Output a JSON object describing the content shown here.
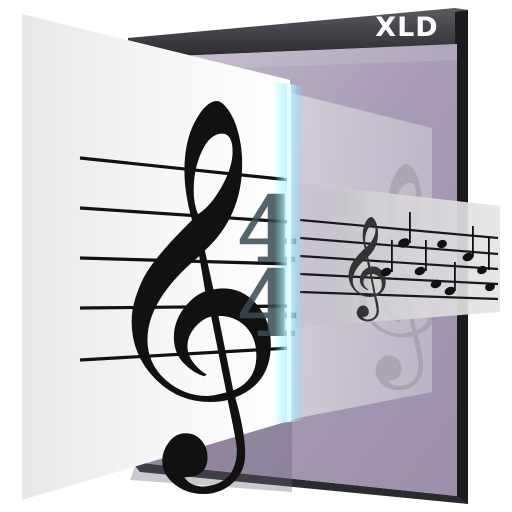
{
  "app": {
    "name": "XLD",
    "icon_description_name": "xld-app-icon"
  },
  "icon": {
    "glyphs": {
      "clef": "treble-clef",
      "time_signature_top": "4",
      "time_signature_bottom": "4"
    },
    "colors": {
      "frame_dark": "#3a3a3f",
      "frame_side": "#1c1c20",
      "panel_purple": "#b3a9bf",
      "paper_white": "#f3f3f3",
      "glow_cyan": "#8ee8ff",
      "ink": "#111111"
    }
  }
}
